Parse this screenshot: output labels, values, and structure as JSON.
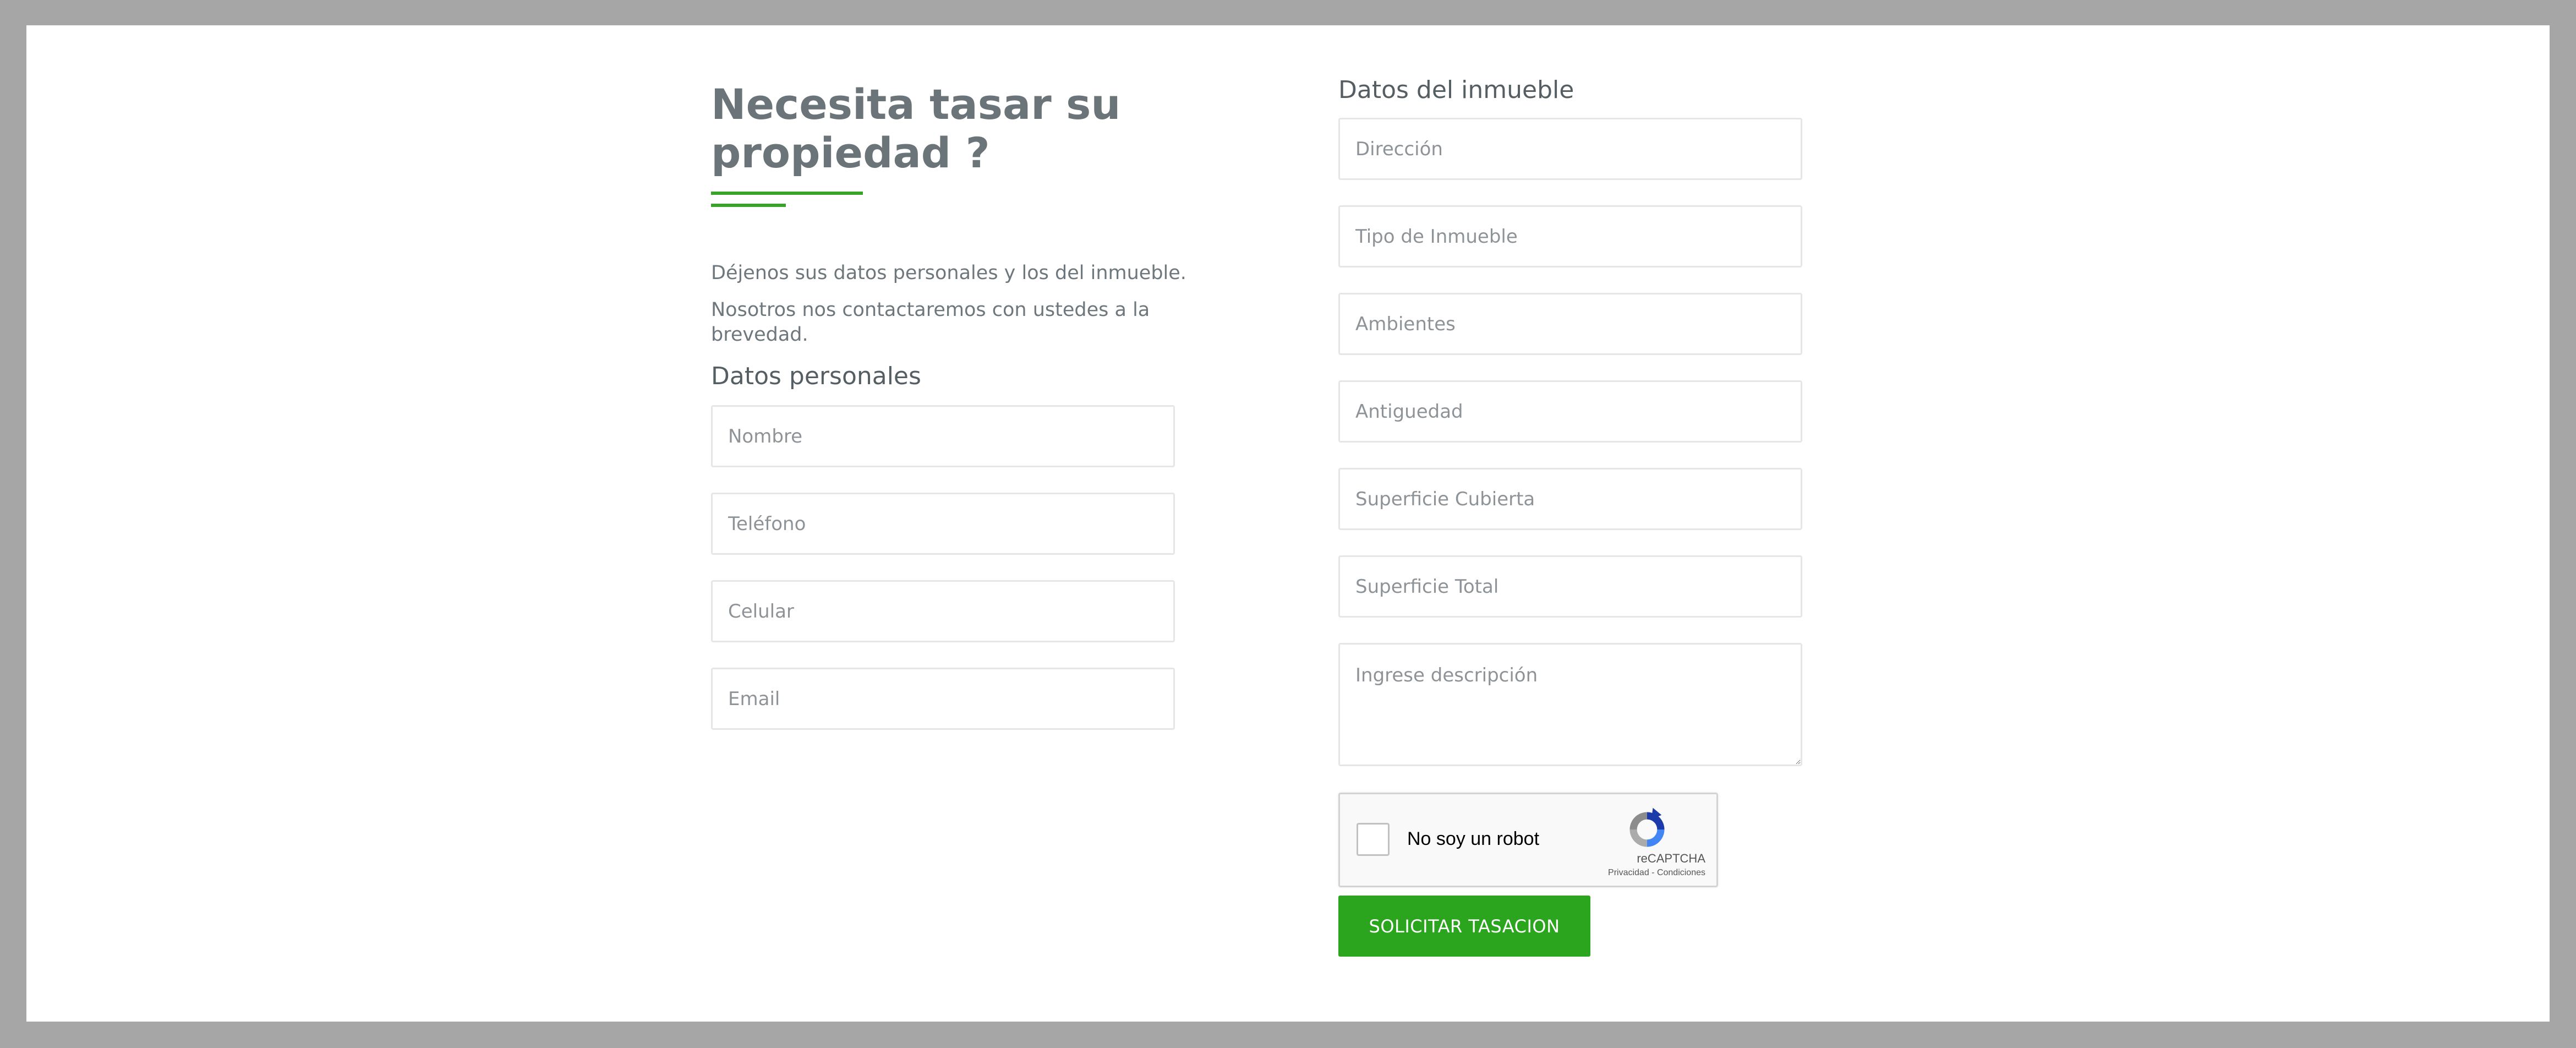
{
  "intro": {
    "title": "Necesita tasar su propiedad ?",
    "line1": "Déjenos sus datos personales y los del inmueble.",
    "line2": "Nosotros nos contactaremos con ustedes a la brevedad."
  },
  "personal": {
    "title": "Datos personales",
    "fields": [
      {
        "placeholder": "Nombre"
      },
      {
        "placeholder": "Teléfono"
      },
      {
        "placeholder": "Celular"
      },
      {
        "placeholder": "Email"
      }
    ]
  },
  "property": {
    "title": "Datos del inmueble",
    "fields": [
      {
        "placeholder": "Dirección"
      },
      {
        "placeholder": "Tipo de Inmueble"
      },
      {
        "placeholder": "Ambientes"
      },
      {
        "placeholder": "Antiguedad"
      },
      {
        "placeholder": "Superficie Cubierta"
      },
      {
        "placeholder": "Superficie Total"
      }
    ],
    "description_placeholder": "Ingrese descripción"
  },
  "captcha": {
    "label": "No soy un robot",
    "brand": "reCAPTCHA",
    "links": "Privacidad - Condiciones"
  },
  "submit_label": "SOLICITAR TASACION",
  "colors": {
    "accent": "#2ba51d",
    "background": "#a6a6a6",
    "heading": "#6b7479"
  }
}
